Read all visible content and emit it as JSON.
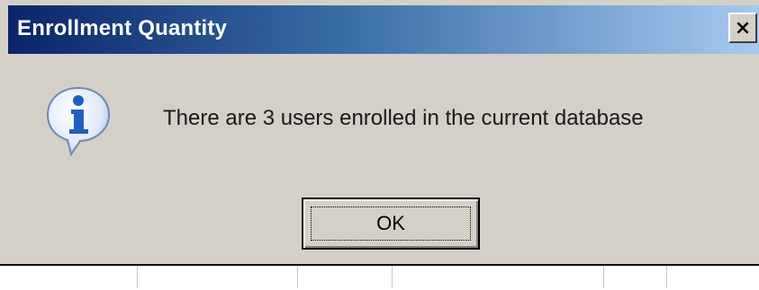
{
  "dialog": {
    "title": "Enrollment Quantity",
    "close_label": "×",
    "message": "There are 3 users enrolled in the current database",
    "ok_label": "OK",
    "icon": "info-icon"
  },
  "colors": {
    "titlebar_start": "#0a246a",
    "titlebar_end": "#a6caf0",
    "window_bg": "#d4d0c8",
    "icon_blue": "#1f5fbf"
  }
}
